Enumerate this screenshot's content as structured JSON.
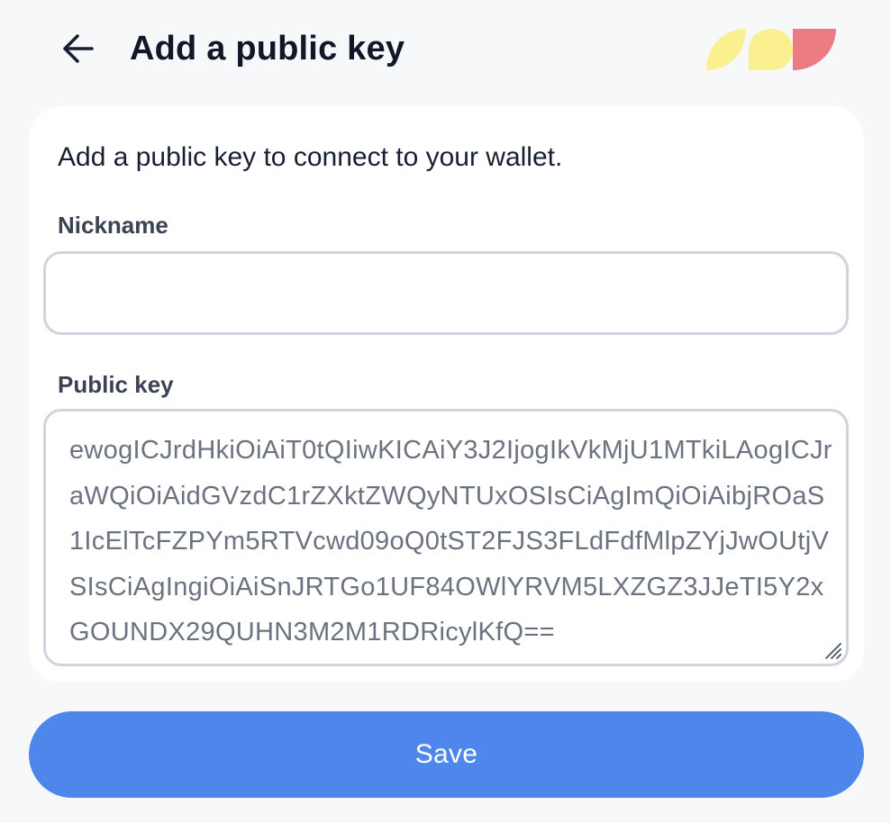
{
  "header": {
    "back_icon": "arrow-left-icon",
    "title": "Add a public key",
    "logo_colors": [
      "#fbf08f",
      "#fbf08f",
      "#ec7b84"
    ]
  },
  "form": {
    "intro": "Add a public key to connect to your wallet.",
    "nickname": {
      "label": "Nickname",
      "value": "",
      "placeholder": ""
    },
    "public_key": {
      "label": "Public key",
      "value": "ewogICJrdHkiOiAiT0tQIiwKICAiY3J2IjogIkVkMjU1MTkiLAogICJraWQiOiAidGVzdC1rZXktZWQyNTUxOSIsCiAgImQiOiAibjROaS1IcElTcFZPYm5RTVcwd09oQ0tST2FJS3FLdFdfMlpZYjJwOUtjVSIsCiAgIngiOiAiSnJRTGo1UF84OWlYRVM5LXZGZ3JJeTI5Y2xGOUNDX29QUHN3M2M1RDRicylKfQ=="
    }
  },
  "actions": {
    "save_label": "Save"
  },
  "colors": {
    "accent": "#4f86eb",
    "background": "#f7f8fa",
    "card": "#ffffff",
    "border": "#cfd5df"
  }
}
